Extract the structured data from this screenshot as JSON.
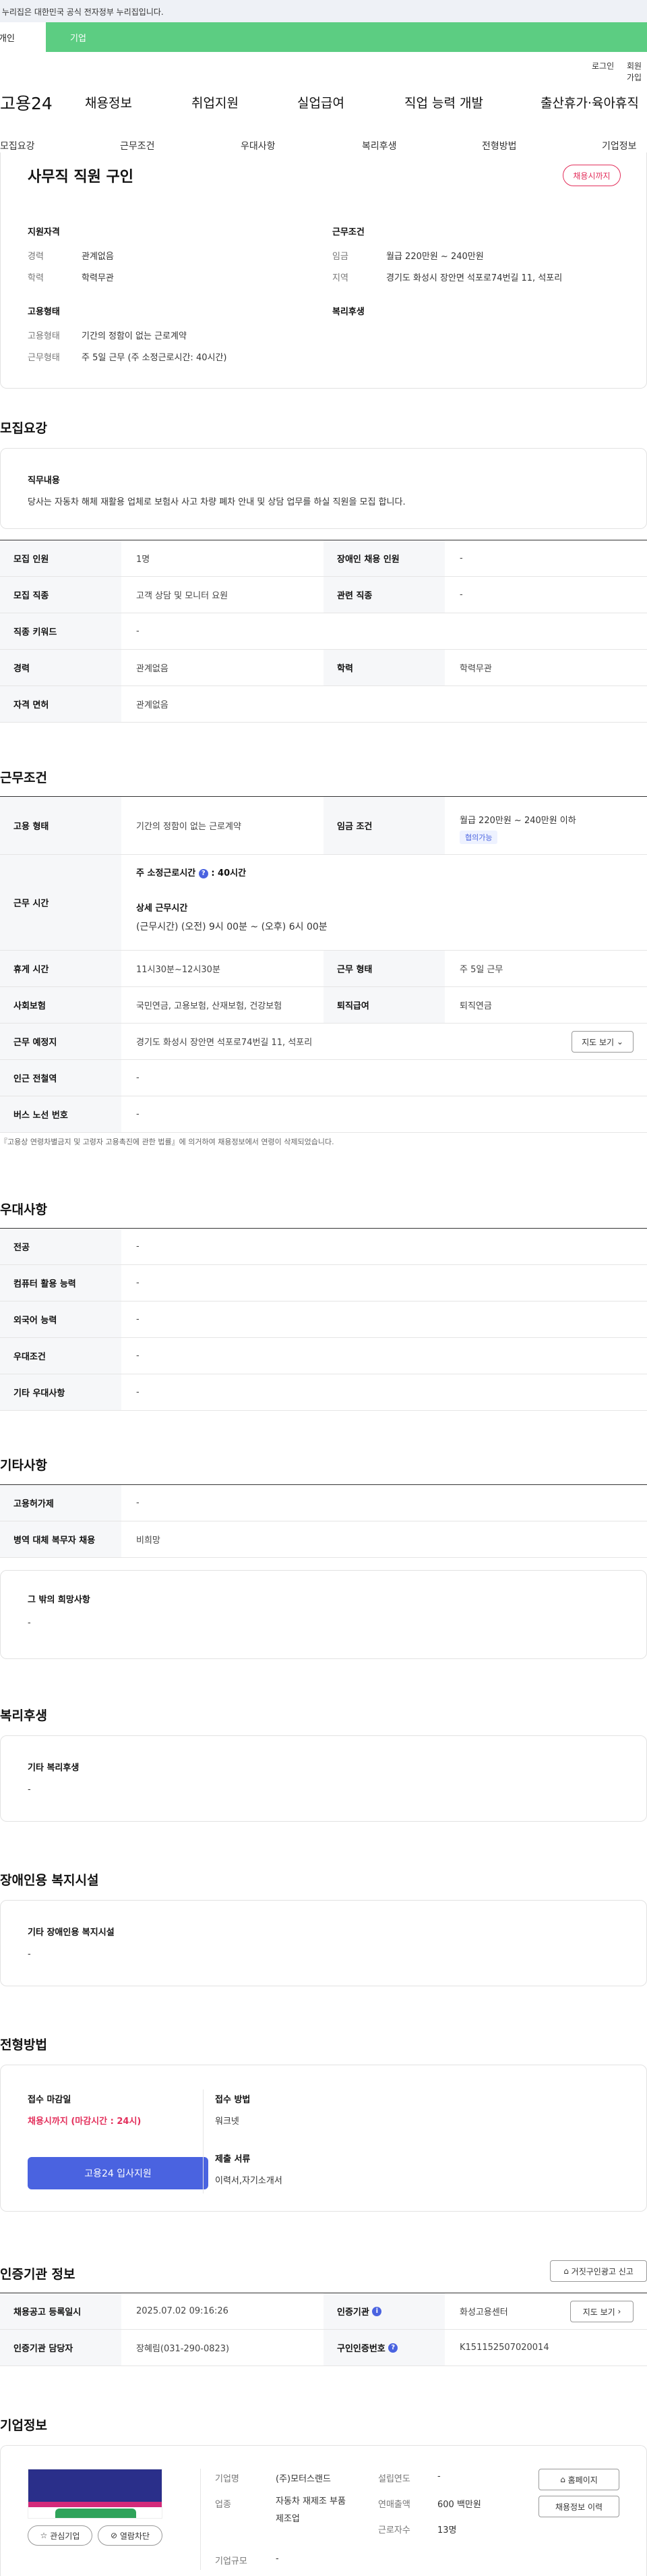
{
  "gov_banner": "이 누리집은 대한민국 공식 전자정부 누리집입니다.",
  "top_tabs": {
    "active": "개인",
    "other": "기업"
  },
  "util_links": {
    "login": "로그인",
    "join": "회원가입"
  },
  "site_logo": "고용24",
  "gnb": [
    "채용정보",
    "취업지원",
    "실업급여",
    "직업 능력 개발",
    "출산휴가·육아휴직"
  ],
  "sub_tabs": [
    "모집요강",
    "근무조건",
    "우대사항",
    "복리후생",
    "전형방법",
    "기업정보"
  ],
  "job": {
    "title": "사무직 직원 구인",
    "status_badge": "채용시까지",
    "summary": {
      "qual_heading": "지원자격",
      "career_k": "경력",
      "career_v": "관계없음",
      "edu_k": "학력",
      "edu_v": "학력무관",
      "cond_heading": "근무조건",
      "wage_k": "임금",
      "wage_v": "월급 220만원 ~ 240만원",
      "area_k": "지역",
      "area_v": "경기도 화성시 장안면 석포로74번길 11, 석포리",
      "emp_heading": "고용형태",
      "emp1_k": "고용형태",
      "emp1_v": "기간의 정함이 없는 근로계약",
      "emp2_k": "근무형태",
      "emp2_v": "주 5일 근무 (주 소정근로시간: 40시간)",
      "welfare_heading": "복리후생"
    }
  },
  "recruit": {
    "title": "모집요강",
    "duty_heading": "직무내용",
    "duty_text": "당사는 자동차 해체 재활용 업체로 보험사 사고 차량 폐차 안내 및 상담 업무를 하실 직원을 모집 합니다.",
    "rows": [
      {
        "k1": "모집 인원",
        "v1": "1명",
        "k2": "장애인 채용 인원",
        "v2": "-"
      },
      {
        "k1": "모집 직종",
        "v1": "고객 상담 및 모니터 요원",
        "k2": "관련 직종",
        "v2": "-"
      },
      {
        "k1": "직종 키워드",
        "v1": "-"
      },
      {
        "k1": "경력",
        "v1": "관계없음",
        "k2": "학력",
        "v2": "학력무관"
      },
      {
        "k1": "자격 면허",
        "v1": "관계없음"
      }
    ]
  },
  "work": {
    "title": "근무조건",
    "emp_k": "고용 형태",
    "emp_v": "기간의 정함이 없는 근로계약",
    "wage_k": "임금 조건",
    "wage_v": "월급 220만원 ~ 240만원 이하",
    "wage_tag": "협의가능",
    "hours_k": "근무 시간",
    "hours_label": "주 소정근로시간",
    "hours_q": "?",
    "hours_val": ": 40시간",
    "detail_label": "상세 근무시간",
    "detail_val": "(근무시간) (오전) 9시 00분 ~ (오후) 6시 00분",
    "break_k": "휴게 시간",
    "break_v": "11시30분~12시30분",
    "form_k": "근무 형태",
    "form_v": "주 5일 근무",
    "ins_k": "사회보험",
    "ins_v": "국민연금, 고용보험, 산재보험, 건강보험",
    "sev_k": "퇴직급여",
    "sev_v": "퇴직연금",
    "place_k": "근무 예정지",
    "place_v": "경기도 화성시 장안면 석포로74번길 11, 석포리",
    "map_btn": "지도 보기",
    "station_k": "인근 전철역",
    "station_v": "-",
    "bus_k": "버스 노선 번호",
    "bus_v": "-",
    "notice": "『고용상 연령차별금지 및 고령자 고용촉진에 관한 법률』에 의거하여 채용정보에서 연령이 삭제되었습니다."
  },
  "pref": {
    "title": "우대사항",
    "rows": [
      {
        "k": "전공",
        "v": "-"
      },
      {
        "k": "컴퓨터 활용 능력",
        "v": "-"
      },
      {
        "k": "외국어 능력",
        "v": "-"
      },
      {
        "k": "우대조건",
        "v": "-"
      },
      {
        "k": "기타 우대사항",
        "v": "-"
      }
    ]
  },
  "etc": {
    "title": "기타사항",
    "rows": [
      {
        "k": "고용허가제",
        "v": "-"
      },
      {
        "k": "병역 대체 복무자 채용",
        "v": "비희망"
      }
    ],
    "wish_heading": "그 밖의 희망사항",
    "wish_text": "-"
  },
  "welfare": {
    "title": "복리후생",
    "heading": "기타 복리후생",
    "text": "-"
  },
  "disabled": {
    "title": "장애인용 복지시설",
    "heading": "기타 장애인용 복지시설",
    "text": "-"
  },
  "screening": {
    "title": "전형방법",
    "deadline_heading": "접수 마감일",
    "deadline_text": "채용시까지 (마감시간 : 24시)",
    "apply_btn": "고용24 입사지원",
    "method_heading": "접수 방법",
    "method_text": "워크넷",
    "docs_heading": "제출 서류",
    "docs_text": "이력서,자기소개서"
  },
  "cert": {
    "title": "인증기관 정보",
    "report_btn": "거짓구인광고 신고",
    "reg_k": "채용공고 등록일시",
    "reg_v": "2025.07.02 09:16:26",
    "org_k": "인증기관",
    "org_v": "화성고용센터",
    "map_btn": "지도 보기",
    "mgr_k": "인증기관 담당자",
    "mgr_v": "장혜림(031-290-0823)",
    "no_k": "구인인증번호",
    "no_v": "K151152507020014"
  },
  "company": {
    "title": "기업정보",
    "fav_btn": "관심기업",
    "block_btn": "열람차단",
    "name_k": "기업명",
    "name_v": "(주)모터스랜드",
    "est_k": "설립연도",
    "est_v": "-",
    "ind_k": "업종",
    "ind_v": "자동차 재제조 부품 제조업",
    "sales_k": "연매출액",
    "sales_v": "600 백만원",
    "emp_k": "근로자수",
    "emp_v": "13명",
    "size_k": "기업규모",
    "size_v": "-",
    "home_btn": "홈페이지",
    "history_btn": "채용정보 이력"
  },
  "colors": {
    "brand_green": "#5ccd82",
    "accent_blue": "#4a63e0",
    "badge_red": "#e3305c"
  }
}
